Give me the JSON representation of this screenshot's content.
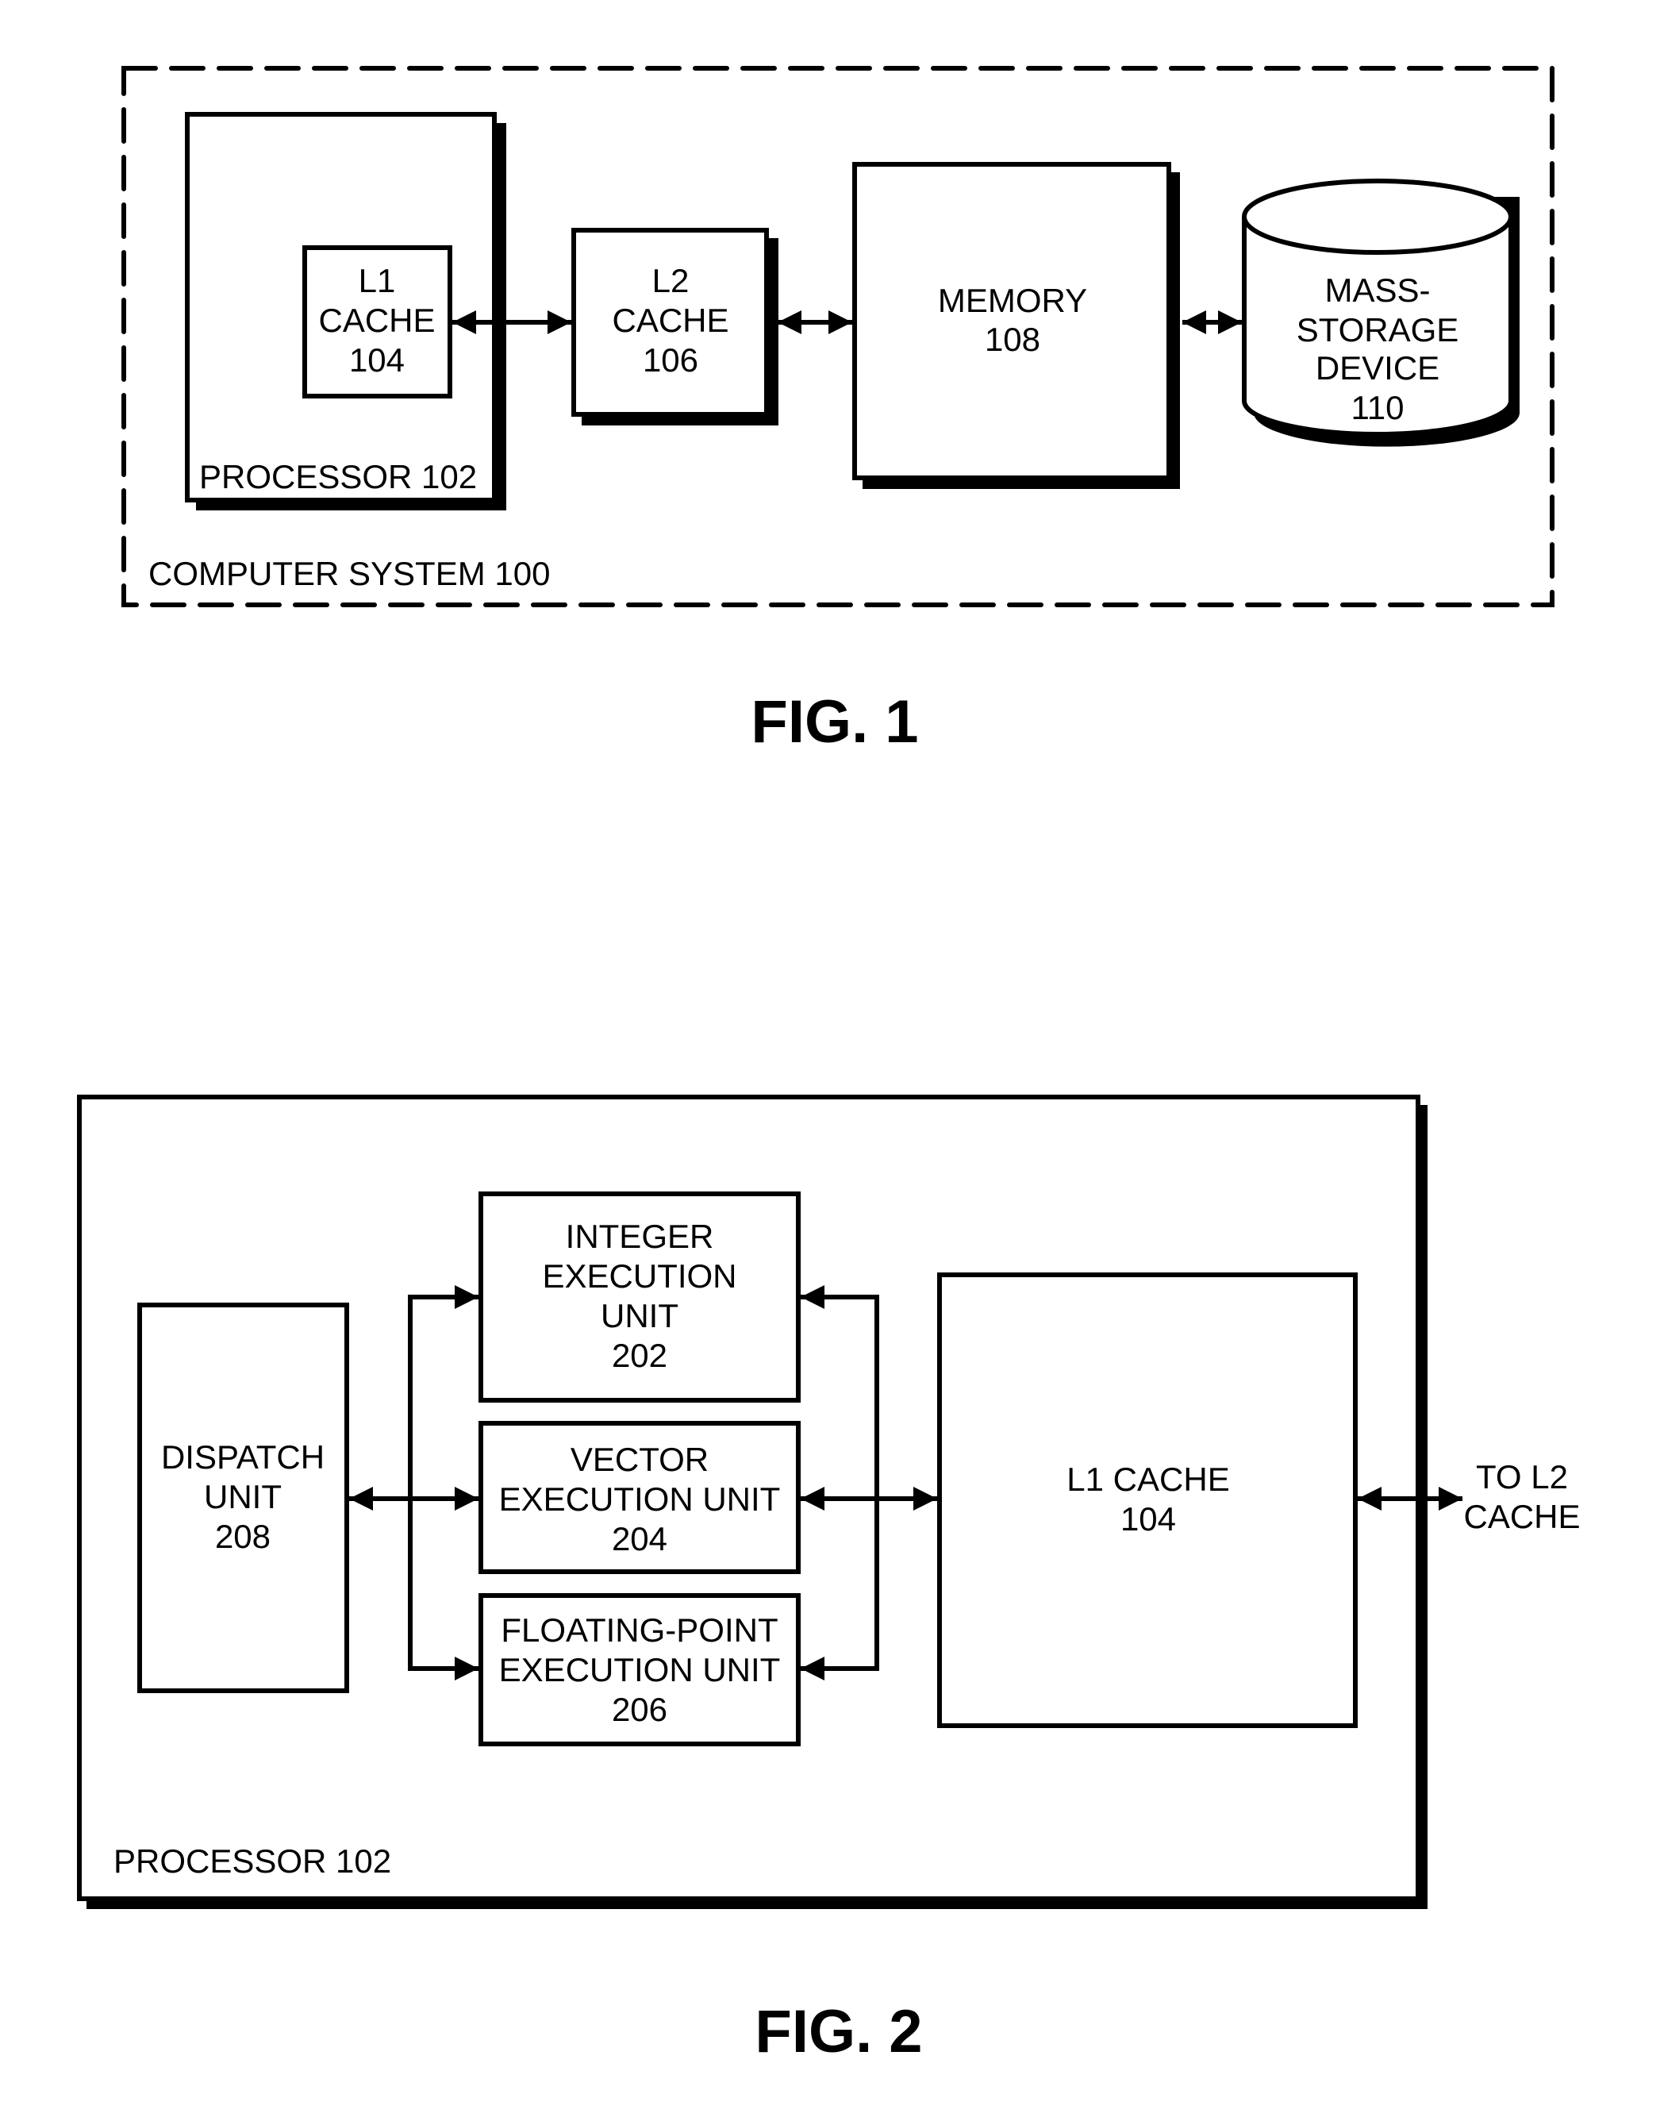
{
  "figure1": {
    "caption": "FIG. 1",
    "system_label": "COMPUTER SYSTEM 100",
    "processor_label": "PROCESSOR 102",
    "l1_cache": [
      "L1",
      "CACHE",
      "104"
    ],
    "l2_cache": [
      "L2",
      "CACHE",
      "106"
    ],
    "memory": [
      "MEMORY",
      "108"
    ],
    "mass_storage": [
      "MASS-",
      "STORAGE",
      "DEVICE",
      "110"
    ]
  },
  "figure2": {
    "caption": "FIG. 2",
    "processor_label": "PROCESSOR 102",
    "dispatch_unit": [
      "DISPATCH",
      "UNIT",
      "208"
    ],
    "integer_unit": [
      "INTEGER",
      "EXECUTION",
      "UNIT",
      "202"
    ],
    "vector_unit": [
      "VECTOR",
      "EXECUTION UNIT",
      "204"
    ],
    "fp_unit": [
      "FLOATING-POINT",
      "EXECUTION UNIT",
      "206"
    ],
    "l1_cache": [
      "L1 CACHE",
      "104"
    ],
    "to_l2": [
      "TO L2",
      "CACHE"
    ]
  }
}
